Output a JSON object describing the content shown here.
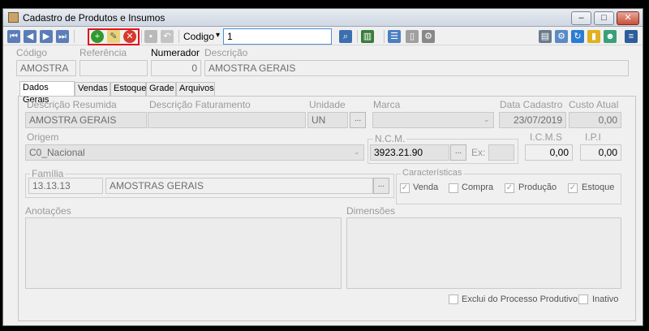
{
  "window": {
    "title": "Cadastro de Produtos e Insumos",
    "controls": {
      "minimize": "–",
      "maximize": "□",
      "close": "✕"
    }
  },
  "toolbar": {
    "search_field_label": "Codigo",
    "search_value": "1",
    "dropdown_arrow": "▾"
  },
  "header": {
    "codigo_label": "Código",
    "codigo_value": "AMOSTRA",
    "referencia_label": "Referência",
    "referencia_value": "",
    "numerador_label": "Numerador",
    "numerador_value": "0",
    "descricao_label": "Descrição",
    "descricao_value": "AMOSTRA GERAIS"
  },
  "tabs": [
    {
      "label": "Dados Gerais",
      "active": true
    },
    {
      "label": "Vendas",
      "active": false
    },
    {
      "label": "Estoque",
      "active": false
    },
    {
      "label": "Grade",
      "active": false
    },
    {
      "label": "Arquivos",
      "active": false
    }
  ],
  "form": {
    "desc_resumida_label": "Descrição Resumida",
    "desc_resumida_value": "AMOSTRA GERAIS",
    "desc_faturamento_label": "Descrição Faturamento",
    "desc_faturamento_value": "",
    "unidade_label": "Unidade",
    "unidade_value": "UN",
    "marca_label": "Marca",
    "marca_value": "",
    "data_cadastro_label": "Data Cadastro",
    "data_cadastro_value": "23/07/2019",
    "custo_atual_label": "Custo Atual",
    "custo_atual_value": "0,00",
    "origem_label": "Origem",
    "origem_value": "C0_Nacional",
    "ncm_label": "N.C.M.",
    "ncm_value": "3923.21.90",
    "ex_label": "Ex:",
    "ex_value": "",
    "icms_label": "I.C.M.S",
    "icms_value": "0,00",
    "ipi_label": "I.P.I",
    "ipi_value": "0,00",
    "familia_label": "Família",
    "familia_code": "13.13.13",
    "familia_name": "AMOSTRAS GERAIS",
    "caracteristicas_label": "Características",
    "checks": [
      {
        "label": "Venda",
        "checked": true
      },
      {
        "label": "Compra",
        "checked": false
      },
      {
        "label": "Produção",
        "checked": true
      },
      {
        "label": "Estoque",
        "checked": true
      }
    ],
    "anotacoes_label": "Anotações",
    "dimensoes_label": "Dimensões",
    "exclui_label": "Exclui do Processo Produtivo",
    "inativo_label": "Inativo",
    "ellipsis": "...",
    "check_mark": "✓"
  }
}
